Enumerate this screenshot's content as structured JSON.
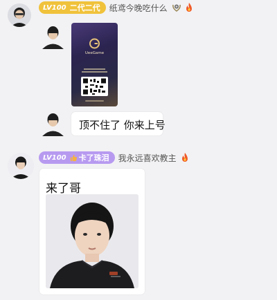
{
  "messages": [
    {
      "badge": {
        "level": "LV100",
        "title": "二代二代",
        "color": "#f0c23b"
      },
      "username": "纸鸢今晚吃什么",
      "icons": [
        "laurel-badge-icon",
        "flame-icon"
      ],
      "sub_messages": [
        {
          "type": "image",
          "card": {
            "logo_text": "UeeGame",
            "caption_lines": [
              "",
              ""
            ]
          }
        },
        {
          "type": "text",
          "text": "顶不住了 你来上号"
        }
      ]
    },
    {
      "badge": {
        "level": "LV100",
        "title": "卡了珠泪",
        "color": "#b79af0"
      },
      "username": "我永远喜欢教主",
      "icons": [
        "flame-icon"
      ],
      "sub_messages": [
        {
          "type": "text-with-image",
          "text": "来了哥"
        }
      ]
    }
  ]
}
